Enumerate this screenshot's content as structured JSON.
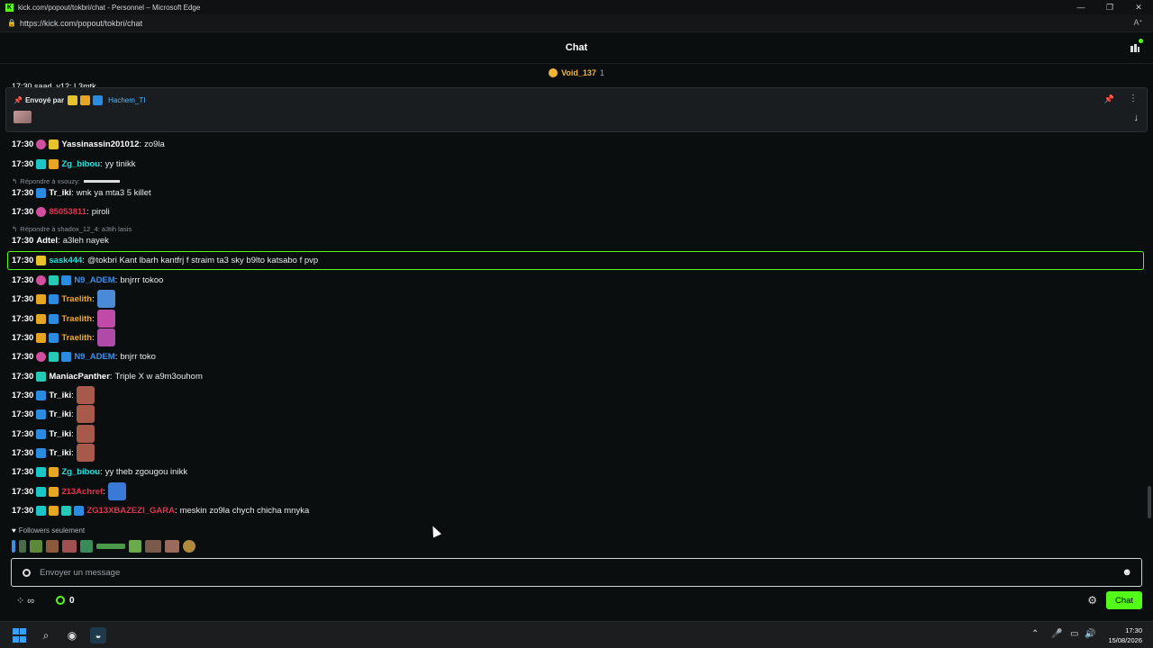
{
  "window": {
    "title": "kick.com/popout/tokbri/chat - Personnel – Microsoft Edge",
    "url": "https://kick.com/popout/tokbri/chat",
    "controls": [
      "—",
      "❐",
      "✕"
    ]
  },
  "header": {
    "title": "Chat"
  },
  "gift_bar": {
    "name": "Void_137",
    "count": "1"
  },
  "partial_line": "17:30 saad_v12: L3mtk",
  "pinned": {
    "label": "Envoyé par",
    "user": "Hachem_TI"
  },
  "messages": [
    {
      "time": "17:30",
      "badges": [
        "b-pink",
        "b-gold"
      ],
      "user": "Yassinassin201012",
      "user_color": "#ffffff",
      "text": "zo9la"
    },
    {
      "time": "17:30",
      "badges": [
        "b-teal",
        "b-crown"
      ],
      "user": "Zg_bibou",
      "user_color": "#1de0e0",
      "text": "yy tinikk"
    },
    {
      "time": "17:30",
      "badges": [
        "b-blue"
      ],
      "user": "Tr_iki",
      "user_color": "#ffffff",
      "text": "wnk ya mta3 5 killet"
    },
    {
      "time": "17:30",
      "badges": [
        "b-pink"
      ],
      "user": "85053811",
      "user_color": "#e0334f",
      "text": "piroli"
    },
    {
      "time": "17:30",
      "badges": [],
      "user": "Adtel",
      "user_color": "#ffffff",
      "text": "a3leh nayek"
    },
    {
      "time": "17:30",
      "badges": [
        "b-gold"
      ],
      "user": "sask444",
      "user_color": "#1de0e0",
      "text": "@tokbri Kant lbarh kantfrj f straim ta3 sky b9lto katsabo f pvp"
    },
    {
      "time": "17:30",
      "badges": [
        "b-pink",
        "b-sub",
        "b-blue"
      ],
      "user": "N9_ADEM",
      "user_color": "#3a8fe8",
      "text": "bnjrrr tokoo"
    },
    {
      "time": "17:30",
      "badges": [
        "b-crown",
        "b-blue"
      ],
      "user": "Traelith",
      "user_color": "#f5a623",
      "text": ""
    },
    {
      "time": "17:30",
      "badges": [
        "b-crown",
        "b-blue"
      ],
      "user": "Traelith",
      "user_color": "#f5a623",
      "text": ""
    },
    {
      "time": "17:30",
      "badges": [
        "b-crown",
        "b-blue"
      ],
      "user": "Traelith",
      "user_color": "#f5a623",
      "text": ""
    },
    {
      "time": "17:30",
      "badges": [
        "b-pink",
        "b-sub",
        "b-blue"
      ],
      "user": "N9_ADEM",
      "user_color": "#3a8fe8",
      "text": "bnjrr toko"
    },
    {
      "time": "17:30",
      "badges": [
        "b-sub"
      ],
      "user": "ManiacPanther",
      "user_color": "#ffffff",
      "text": "Triple X w a9m3ouhom"
    },
    {
      "time": "17:30",
      "badges": [
        "b-blue"
      ],
      "user": "Tr_iki",
      "user_color": "#ffffff",
      "text": ""
    },
    {
      "time": "17:30",
      "badges": [
        "b-blue"
      ],
      "user": "Tr_iki",
      "user_color": "#ffffff",
      "text": ""
    },
    {
      "time": "17:30",
      "badges": [
        "b-blue"
      ],
      "user": "Tr_iki",
      "user_color": "#ffffff",
      "text": ""
    },
    {
      "time": "17:30",
      "badges": [
        "b-blue"
      ],
      "user": "Tr_iki",
      "user_color": "#ffffff",
      "text": ""
    },
    {
      "time": "17:30",
      "badges": [
        "b-teal",
        "b-crown"
      ],
      "user": "Zg_bibou",
      "user_color": "#1de0e0",
      "text": "yy theb zgougou inikk"
    },
    {
      "time": "17:30",
      "badges": [
        "b-teal",
        "b-crown"
      ],
      "user": "213Achref",
      "user_color": "#e0334f",
      "text": ""
    },
    {
      "time": "17:30",
      "badges": [
        "b-teal",
        "b-crown",
        "b-sub",
        "b-blue"
      ],
      "user": "ZG13XBAZEZI_GARA",
      "user_color": "#e0334f",
      "text": "meskin zo9la chych chicha mnyka"
    }
  ],
  "replies": [
    {
      "text": "Répondre à xsouzy:"
    },
    {
      "text": "Répondre à shadox_12_4: a3tih lasis"
    }
  ],
  "followers_label": "Followers seulement",
  "input": {
    "placeholder": "Envoyer un message"
  },
  "bottom": {
    "points": "0",
    "chat_button": "Chat"
  },
  "taskbar": {
    "time": "17:30",
    "date": "15/08/2026"
  }
}
